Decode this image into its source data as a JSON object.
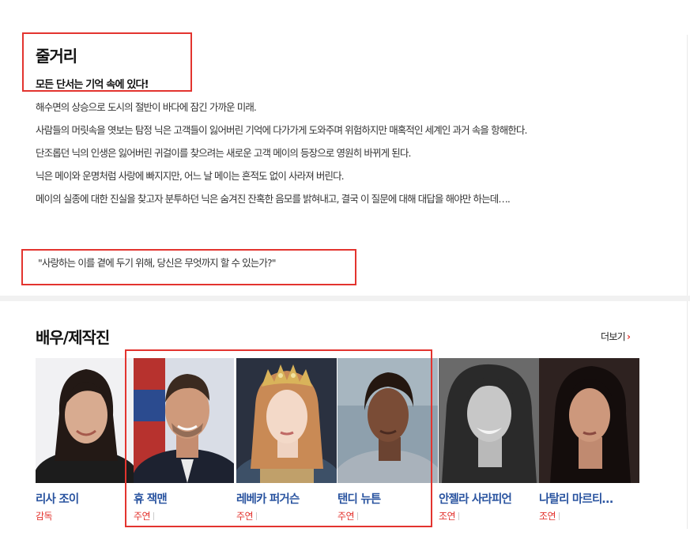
{
  "storyline": {
    "title": "줄거리",
    "tagline": "모든 단서는 기억 속에 있다!",
    "paragraphs": [
      "해수면의 상승으로 도시의 절반이 바다에 잠긴 가까운 미래.",
      " 사람들의 머릿속을 엿보는 탐정 닉은 고객들이 잃어버린 기억에 다가가게 도와주며 위험하지만 매혹적인 세계인 과거 속을 항해한다.",
      " 단조롭던 닉의 인생은 잃어버린 귀걸이를 찾으려는 새로운 고객 메이의 등장으로 영원히 바뀌게 된다.",
      " 닉은 메이와 운명처럼 사랑에 빠지지만, 어느 날 메이는 흔적도 없이 사라져 버린다.",
      " 메이의 실종에 대한 진실을 찾고자 분투하던 닉은 숨겨진 잔혹한 음모를 밝혀내고, 결국 이 질문에 대해 대답을 해야만 하는데…."
    ],
    "quote": "\"사랑하는 이를 곁에 두기 위해, 당신은 무엇까지 할 수 있는가?\""
  },
  "cast": {
    "heading": "배우/제작진",
    "more_label": "더보기",
    "more_icon": "chevron-right-icon",
    "accent_color": "#e3342f",
    "name_color": "#2a54a0",
    "members": [
      {
        "name": "리사 조이",
        "role": "감독"
      },
      {
        "name": "휴 잭맨",
        "role": "주연"
      },
      {
        "name": "레베카 퍼거슨",
        "role": "주연"
      },
      {
        "name": "탠디 뉴튼",
        "role": "주연"
      },
      {
        "name": "안젤라 사라피언",
        "role": "조연"
      },
      {
        "name": "나탈리 마르티…",
        "role": "조연"
      }
    ]
  }
}
